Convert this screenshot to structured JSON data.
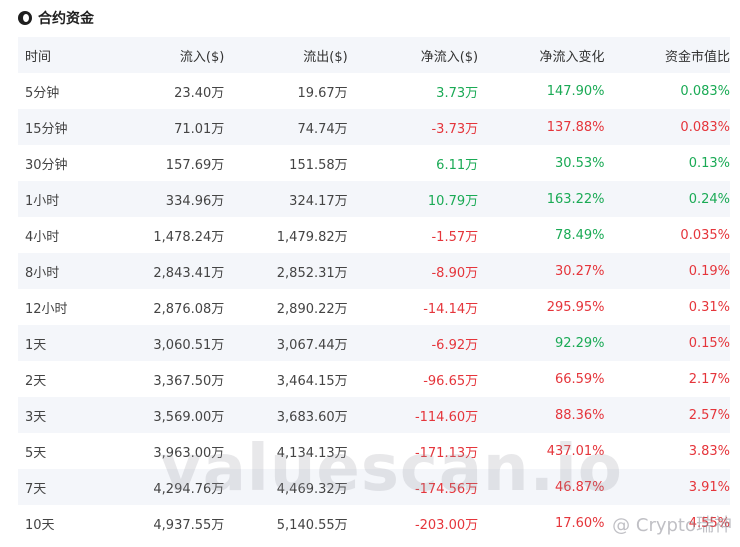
{
  "header": {
    "title": "合约资金",
    "logo_icon": "coin-logo-icon"
  },
  "table": {
    "columns": [
      "时间",
      "流入($)",
      "流出($)",
      "净流入($)",
      "净流入变化",
      "资金市值比"
    ],
    "rows": [
      {
        "time": "5分钟",
        "inflow": "23.40万",
        "outflow": "19.67万",
        "net": "3.73万",
        "net_dir": "green",
        "change": "147.90%",
        "change_dir": "green",
        "ratio": "0.083%",
        "ratio_dir": "green"
      },
      {
        "time": "15分钟",
        "inflow": "71.01万",
        "outflow": "74.74万",
        "net": "-3.73万",
        "net_dir": "red",
        "change": "137.88%",
        "change_dir": "red",
        "ratio": "0.083%",
        "ratio_dir": "red"
      },
      {
        "time": "30分钟",
        "inflow": "157.69万",
        "outflow": "151.58万",
        "net": "6.11万",
        "net_dir": "green",
        "change": "30.53%",
        "change_dir": "green",
        "ratio": "0.13%",
        "ratio_dir": "green"
      },
      {
        "time": "1小时",
        "inflow": "334.96万",
        "outflow": "324.17万",
        "net": "10.79万",
        "net_dir": "green",
        "change": "163.22%",
        "change_dir": "green",
        "ratio": "0.24%",
        "ratio_dir": "green"
      },
      {
        "time": "4小时",
        "inflow": "1,478.24万",
        "outflow": "1,479.82万",
        "net": "-1.57万",
        "net_dir": "red",
        "change": "78.49%",
        "change_dir": "green",
        "ratio": "0.035%",
        "ratio_dir": "red"
      },
      {
        "time": "8小时",
        "inflow": "2,843.41万",
        "outflow": "2,852.31万",
        "net": "-8.90万",
        "net_dir": "red",
        "change": "30.27%",
        "change_dir": "red",
        "ratio": "0.19%",
        "ratio_dir": "red"
      },
      {
        "time": "12小时",
        "inflow": "2,876.08万",
        "outflow": "2,890.22万",
        "net": "-14.14万",
        "net_dir": "red",
        "change": "295.95%",
        "change_dir": "red",
        "ratio": "0.31%",
        "ratio_dir": "red"
      },
      {
        "time": "1天",
        "inflow": "3,060.51万",
        "outflow": "3,067.44万",
        "net": "-6.92万",
        "net_dir": "red",
        "change": "92.29%",
        "change_dir": "green",
        "ratio": "0.15%",
        "ratio_dir": "red"
      },
      {
        "time": "2天",
        "inflow": "3,367.50万",
        "outflow": "3,464.15万",
        "net": "-96.65万",
        "net_dir": "red",
        "change": "66.59%",
        "change_dir": "red",
        "ratio": "2.17%",
        "ratio_dir": "red"
      },
      {
        "time": "3天",
        "inflow": "3,569.00万",
        "outflow": "3,683.60万",
        "net": "-114.60万",
        "net_dir": "red",
        "change": "88.36%",
        "change_dir": "red",
        "ratio": "2.57%",
        "ratio_dir": "red"
      },
      {
        "time": "5天",
        "inflow": "3,963.00万",
        "outflow": "4,134.13万",
        "net": "-171.13万",
        "net_dir": "red",
        "change": "437.01%",
        "change_dir": "red",
        "ratio": "3.83%",
        "ratio_dir": "red"
      },
      {
        "time": "7天",
        "inflow": "4,294.76万",
        "outflow": "4,469.32万",
        "net": "-174.56万",
        "net_dir": "red",
        "change": "46.87%",
        "change_dir": "red",
        "ratio": "3.91%",
        "ratio_dir": "red"
      },
      {
        "time": "10天",
        "inflow": "4,937.55万",
        "outflow": "5,140.55万",
        "net": "-203.00万",
        "net_dir": "red",
        "change": "17.60%",
        "change_dir": "red",
        "ratio": "4.55%",
        "ratio_dir": "red"
      }
    ]
  },
  "watermark": {
    "main": "valuescan.io",
    "corner": "@ Crypto瑞神"
  },
  "colors": {
    "green": "#1aaa55",
    "red": "#e5353b",
    "stripe": "#f4f6fa"
  }
}
